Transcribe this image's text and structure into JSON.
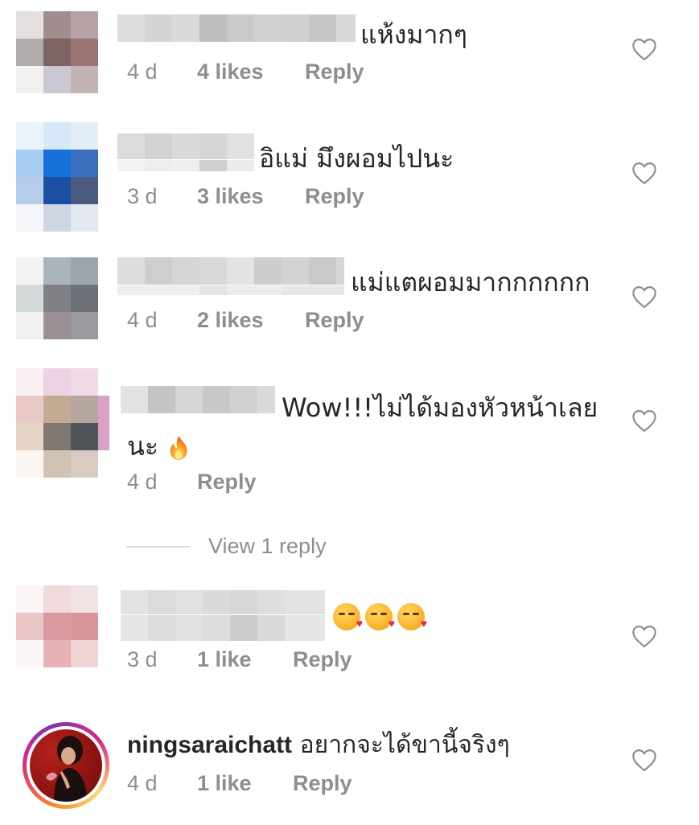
{
  "comments": [
    {
      "text": "แห้งมากๆ",
      "time": "4 d",
      "likes": "4 likes",
      "reply": "Reply"
    },
    {
      "text": "อิแม่ มึงผอมไปนะ",
      "time": "3 d",
      "likes": "3 likes",
      "reply": "Reply"
    },
    {
      "text": "แม่แตผอมมากกกกกก",
      "time": "4 d",
      "likes": "2 likes",
      "reply": "Reply"
    },
    {
      "text_line1": "Wow!!!ไม่ได้มองหัวหน้าเลย",
      "text_line2": "นะ",
      "emoji": "fire",
      "time": "4 d",
      "reply": "Reply",
      "view_replies": "View 1 reply"
    },
    {
      "emojis": [
        "kissing-heart",
        "kissing-heart",
        "kissing-heart"
      ],
      "time": "3 d",
      "likes": "1 like",
      "reply": "Reply"
    },
    {
      "username": "ningsaraichatt",
      "text": "อยากจะได้ขานี้จริงๆ",
      "time": "4 d",
      "likes": "1 like",
      "reply": "Reply"
    }
  ],
  "icons": {
    "like": "heart-outline-icon"
  },
  "colors": {
    "primary_text": "#262626",
    "secondary_text": "#8e8e8e",
    "heart_outline": "#8e8e8e"
  }
}
